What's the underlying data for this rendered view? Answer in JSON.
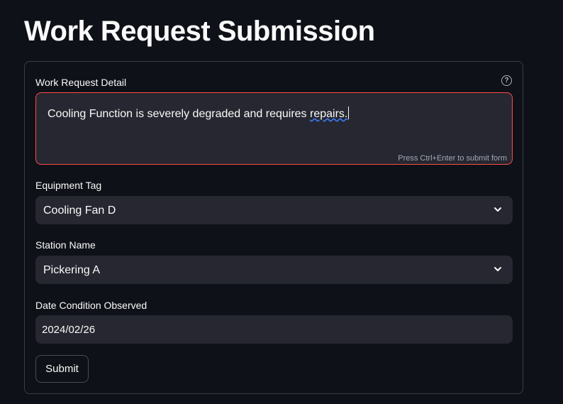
{
  "page": {
    "title": "Work Request Submission"
  },
  "form": {
    "detail": {
      "label": "Work Request Detail",
      "value_prefix": "Cooling Function is severely degraded and requires ",
      "value_underlined": "repairs.",
      "hint": "Press Ctrl+Enter to submit form",
      "help_icon": "question-circle-icon"
    },
    "equipment": {
      "label": "Equipment Tag",
      "value": "Cooling Fan D",
      "icon": "chevron-down-icon"
    },
    "station": {
      "label": "Station Name",
      "value": "Pickering A",
      "icon": "chevron-down-icon"
    },
    "date": {
      "label": "Date Condition Observed",
      "value": "2024/02/26"
    },
    "submit_label": "Submit"
  },
  "colors": {
    "background": "#0e1117",
    "field": "#262730",
    "error_border": "#ff4b4b",
    "text": "#fafafa"
  }
}
